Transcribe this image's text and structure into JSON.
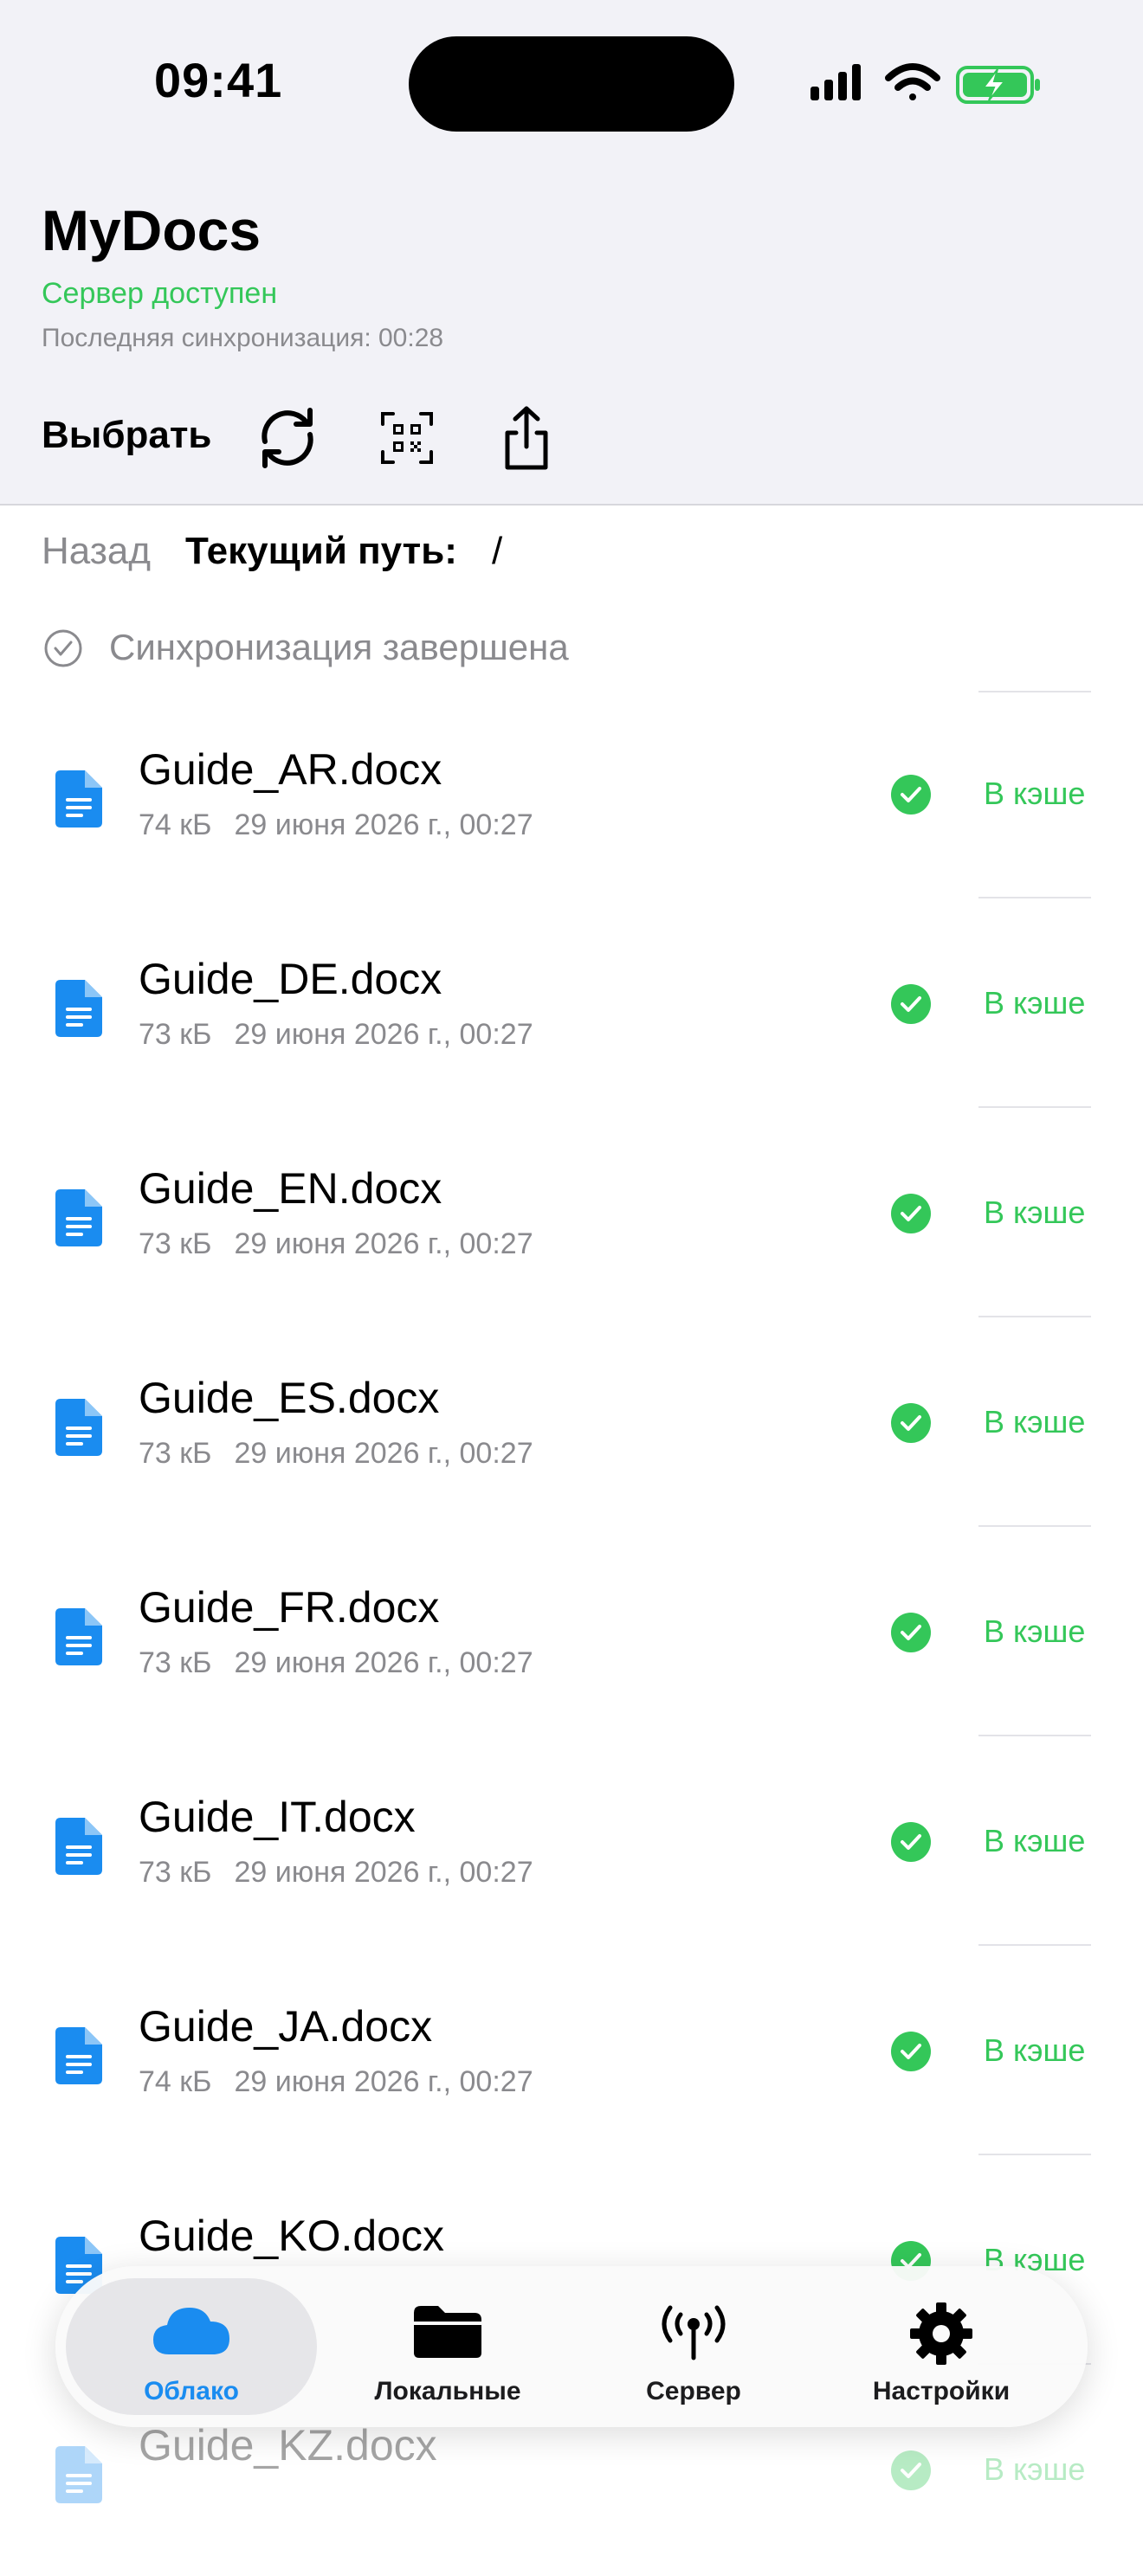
{
  "status_bar": {
    "time": "09:41"
  },
  "header": {
    "title": "MyDocs",
    "server_status": "Сервер доступен",
    "last_sync": "Последняя синхронизация: 00:28",
    "select_label": "Выбрать"
  },
  "nav": {
    "back_label": "Назад",
    "path_label": "Текущий путь:",
    "path_value": "/"
  },
  "sync": {
    "text": "Синхронизация завершена"
  },
  "files": [
    {
      "name": "Guide_AR.docx",
      "size": "74 кБ",
      "date": "29 июня 2026 г., 00:27",
      "status": "В кэше"
    },
    {
      "name": "Guide_DE.docx",
      "size": "73 кБ",
      "date": "29 июня 2026 г., 00:27",
      "status": "В кэше"
    },
    {
      "name": "Guide_EN.docx",
      "size": "73 кБ",
      "date": "29 июня 2026 г., 00:27",
      "status": "В кэше"
    },
    {
      "name": "Guide_ES.docx",
      "size": "73 кБ",
      "date": "29 июня 2026 г., 00:27",
      "status": "В кэше"
    },
    {
      "name": "Guide_FR.docx",
      "size": "73 кБ",
      "date": "29 июня 2026 г., 00:27",
      "status": "В кэше"
    },
    {
      "name": "Guide_IT.docx",
      "size": "73 кБ",
      "date": "29 июня 2026 г., 00:27",
      "status": "В кэше"
    },
    {
      "name": "Guide_JA.docx",
      "size": "74 кБ",
      "date": "29 июня 2026 г., 00:27",
      "status": "В кэше"
    },
    {
      "name": "Guide_KO.docx",
      "size": "",
      "date": "",
      "status": "В кэше"
    },
    {
      "name": "Guide_KZ.docx",
      "size": "",
      "date": "",
      "status": "В кэше"
    }
  ],
  "tabs": [
    {
      "label": "Облако",
      "icon": "cloud-icon",
      "active": true
    },
    {
      "label": "Локальные",
      "icon": "folder-icon",
      "active": false
    },
    {
      "label": "Сервер",
      "icon": "antenna-icon",
      "active": false
    },
    {
      "label": "Настройки",
      "icon": "gear-icon",
      "active": false
    }
  ],
  "colors": {
    "accent": "#1a8cf0",
    "success": "#34c759",
    "secondary_text": "#8a8a8e",
    "header_bg": "#f2f2f7"
  }
}
